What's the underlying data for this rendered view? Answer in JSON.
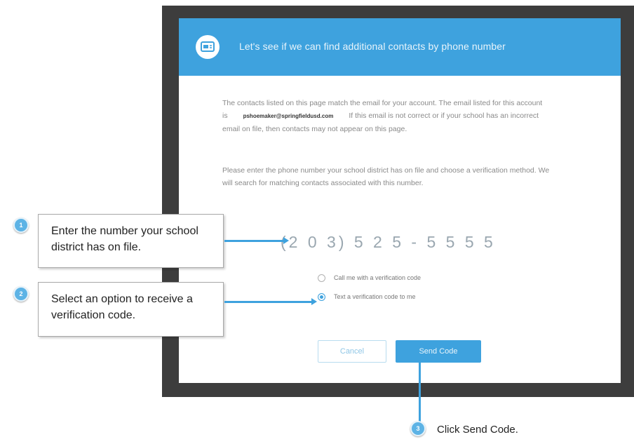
{
  "dialog": {
    "title": "Let's see if we can find additional contacts by phone number",
    "paragraph1_before": "The contacts listed on this page match the email for your account. The email listed for this account is",
    "email": "pshoemaker@springfieldusd.com",
    "paragraph1_after": "If this email is not correct or if your school has an incorrect email on file, then contacts may not appear on this page.",
    "paragraph2": "Please enter the phone number your school district has on file and choose a verification method. We will search for matching contacts associated with this number.",
    "phone_value": "(2 0 3) 5 2 5 - 5 5 5 5",
    "options": [
      {
        "label": "Call me with a verification code",
        "selected": false
      },
      {
        "label": "Text a verification code to me",
        "selected": true
      }
    ],
    "cancel_label": "Cancel",
    "send_label": "Send Code"
  },
  "callouts": [
    {
      "step": "1",
      "text": "Enter the number your school district has on file."
    },
    {
      "step": "2",
      "text": "Select an option to receive a verification code."
    },
    {
      "step": "3",
      "text": "Click Send Code."
    }
  ],
  "colors": {
    "accent": "#3ea2de",
    "backdrop": "#3d3d3d"
  }
}
